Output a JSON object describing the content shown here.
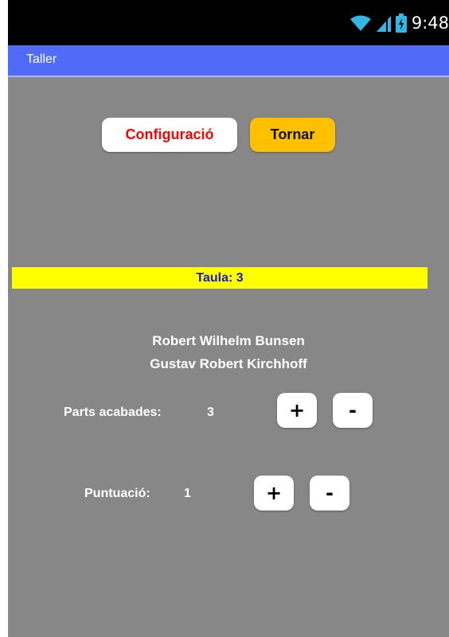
{
  "status_bar": {
    "time": "9:48",
    "icons": [
      "wifi-icon",
      "signal-icon",
      "battery-icon"
    ]
  },
  "app_bar": {
    "title": "Taller"
  },
  "actions": {
    "config_label": "Configuració",
    "back_label": "Tornar"
  },
  "table": {
    "label": "Taula: 3"
  },
  "members": [
    "Robert Wilhelm Bunsen",
    "Gustav Robert Kirchhoff"
  ],
  "finished_parts": {
    "label": "Parts acabades:",
    "value": "3",
    "plus_label": "+",
    "minus_label": "-"
  },
  "score": {
    "label": "Puntuació:",
    "value": "1",
    "plus_label": "+",
    "minus_label": "-"
  },
  "colors": {
    "background": "#878787",
    "app_bar": "#4f6bf8",
    "table_bar": "#ffff00",
    "table_text": "#1a1acc",
    "config_text": "#ff0000",
    "back_button": "#ffc000"
  }
}
